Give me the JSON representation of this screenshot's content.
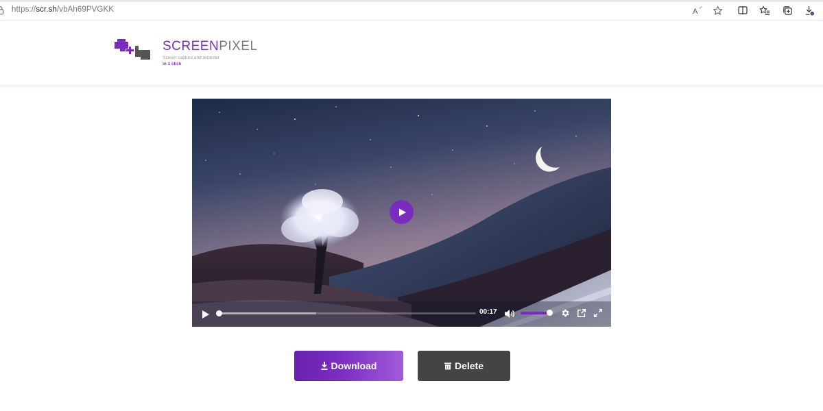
{
  "browser": {
    "url_prefix": "https://",
    "url_host": "scr.sh",
    "url_path": "/vbAh69PVGKK",
    "toolbar_icons": [
      "read-aloud-icon",
      "favorite-star-icon",
      "split-screen-icon",
      "favorites-list-icon",
      "collections-icon",
      "downloads-icon"
    ]
  },
  "header": {
    "brand_part1": "SCREEN",
    "brand_part2": "PIXEL",
    "tagline": "Screen capture and recorder",
    "tagline_accent": "in 1 click"
  },
  "player": {
    "current_time": "00:17",
    "progress_fraction": 0.0,
    "buffered_fraction": 0.38,
    "volume_fraction": 1.0,
    "accent_color": "#7b2cbf"
  },
  "actions": {
    "download_label": "Download",
    "delete_label": "Delete"
  },
  "colors": {
    "brand": "#7b2cbf",
    "delete_bg": "#444444"
  }
}
